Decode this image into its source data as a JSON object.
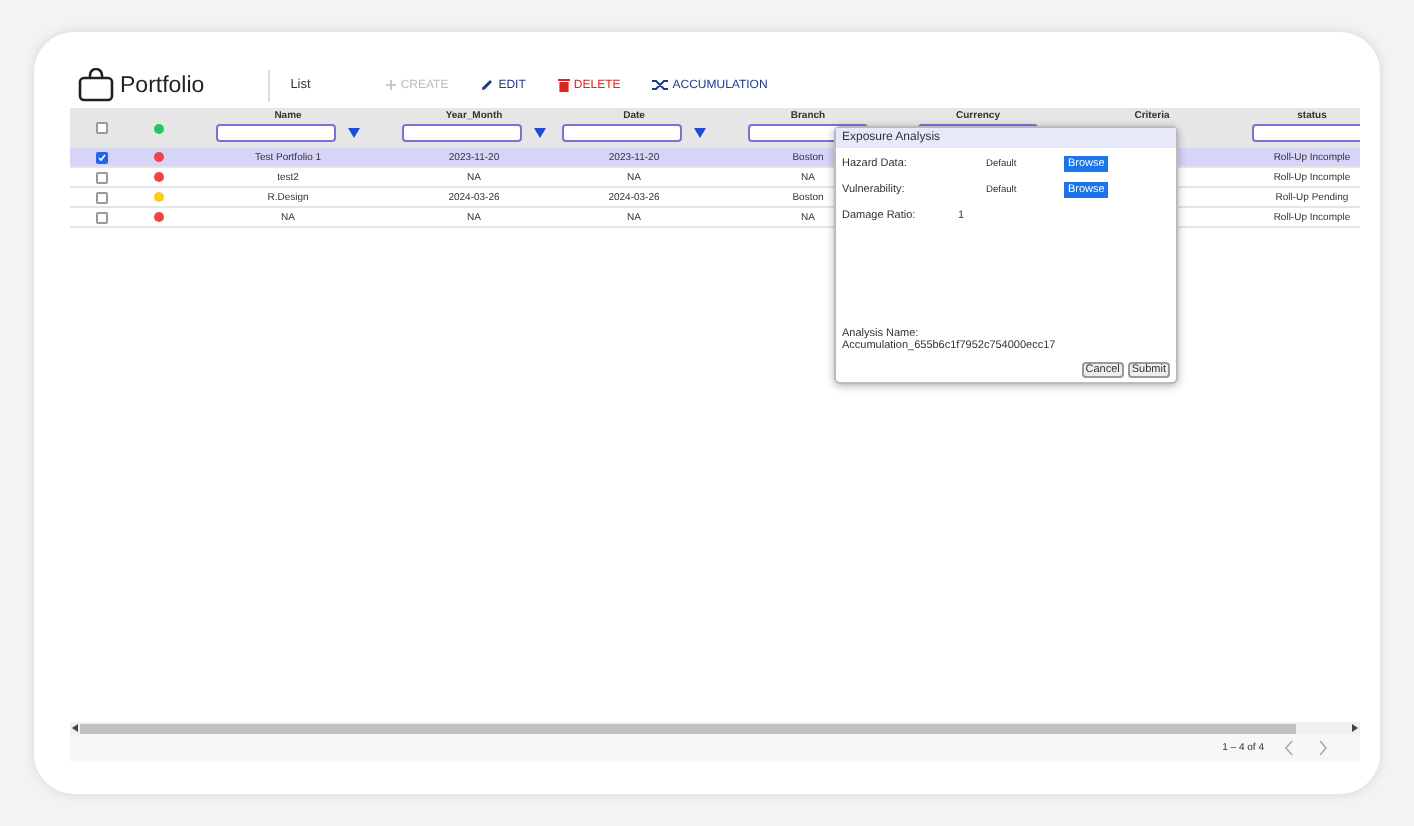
{
  "header": {
    "title": "Portfolio",
    "view": "List"
  },
  "toolbar": [
    {
      "label": "CREATE",
      "kind": "create",
      "disabled": true
    },
    {
      "label": "EDIT",
      "kind": "edit",
      "disabled": false
    },
    {
      "label": "DELETE",
      "kind": "delete",
      "disabled": false
    },
    {
      "label": "ACCUMULATION",
      "kind": "accumulation",
      "disabled": false
    }
  ],
  "table": {
    "select_all_checked": false,
    "columns": [
      {
        "kind": "shown",
        "label": "Name",
        "filter": true,
        "filter_icon": true
      },
      {
        "kind": "shown",
        "label": "Year_Month",
        "filter": true,
        "filter_icon": true
      },
      {
        "kind": "shown",
        "label": "Date",
        "filter": true,
        "filter_icon": true
      },
      {
        "kind": "shown",
        "label": "Branch",
        "filter": true,
        "filter_icon": false
      },
      {
        "kind": "covered",
        "label": "Currency",
        "filter": true,
        "filter_icon": false
      },
      {
        "kind": "covered",
        "label": "Criteria",
        "filter": false,
        "filter_icon": false
      },
      {
        "kind": "shown",
        "label": "status",
        "filter": true,
        "filter_icon": false
      }
    ],
    "rows": [
      {
        "selected": true,
        "color": "#ef4444",
        "cells": [
          "Test Portfolio 1",
          "2023-11-20",
          "2023-11-20",
          "Boston",
          "Roll-Up Incomple"
        ]
      },
      {
        "selected": false,
        "color": "#ef4444",
        "cells": [
          "test2",
          "NA",
          "NA",
          "NA",
          "Roll-Up Incomple"
        ]
      },
      {
        "selected": false,
        "color": "#facc15",
        "cells": [
          "R.Design",
          "2024-03-26",
          "2024-03-26",
          "Boston",
          "Roll-Up Pending"
        ]
      },
      {
        "selected": false,
        "color": "#ef4444",
        "cells": [
          "NA",
          "NA",
          "NA",
          "NA",
          "Roll-Up Incomple"
        ]
      }
    ]
  },
  "dialog": {
    "title": "Exposure Analysis",
    "fields": [
      {
        "label": "Hazard Data:",
        "value": "Default",
        "button": "Browse"
      },
      {
        "label": "Vulnerability:",
        "value": "Default",
        "button": "Browse"
      },
      {
        "label": "Damage Ratio:",
        "value": "1"
      }
    ],
    "analysis_name_label": "Analysis Name:",
    "analysis_name": "Accumulation_655b6c1f7952c754000ecc17",
    "buttons": [
      "Cancel",
      "Submit"
    ]
  },
  "pager": {
    "range": "1 – 4 of 4"
  }
}
